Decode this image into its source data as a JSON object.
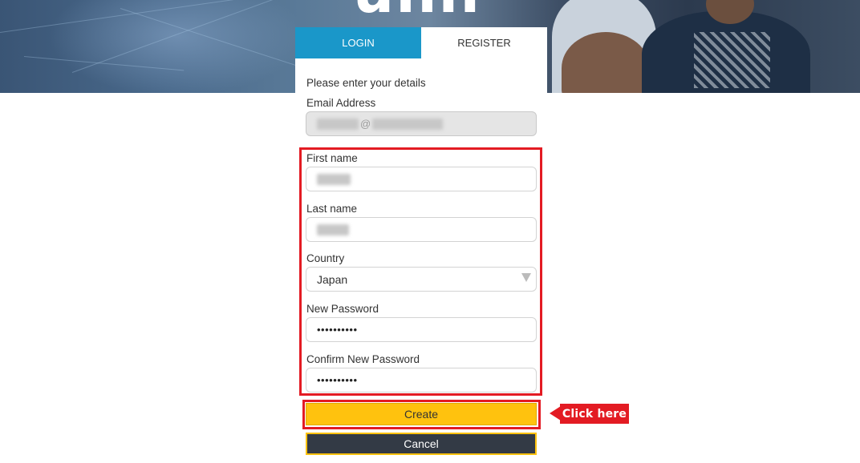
{
  "hero": {
    "logo_text": "unn"
  },
  "tabs": [
    {
      "label": "LOGIN",
      "active": true
    },
    {
      "label": "REGISTER",
      "active": false
    }
  ],
  "form": {
    "intro": "Please enter your details",
    "email": {
      "label": "Email Address",
      "value_separator": "@"
    },
    "first_name": {
      "label": "First name"
    },
    "last_name": {
      "label": "Last name"
    },
    "country": {
      "label": "Country",
      "value": "Japan"
    },
    "new_password": {
      "label": "New Password",
      "value": "••••••••••"
    },
    "confirm_password": {
      "label": "Confirm New Password",
      "value": "••••••••••"
    }
  },
  "buttons": {
    "create": "Create",
    "cancel": "Cancel"
  },
  "annotation": {
    "callout": "Click here"
  },
  "colors": {
    "tab_active": "#1a97c9",
    "create_button": "#ffc20e",
    "cancel_button": "#333a45",
    "highlight": "#e31b23"
  }
}
